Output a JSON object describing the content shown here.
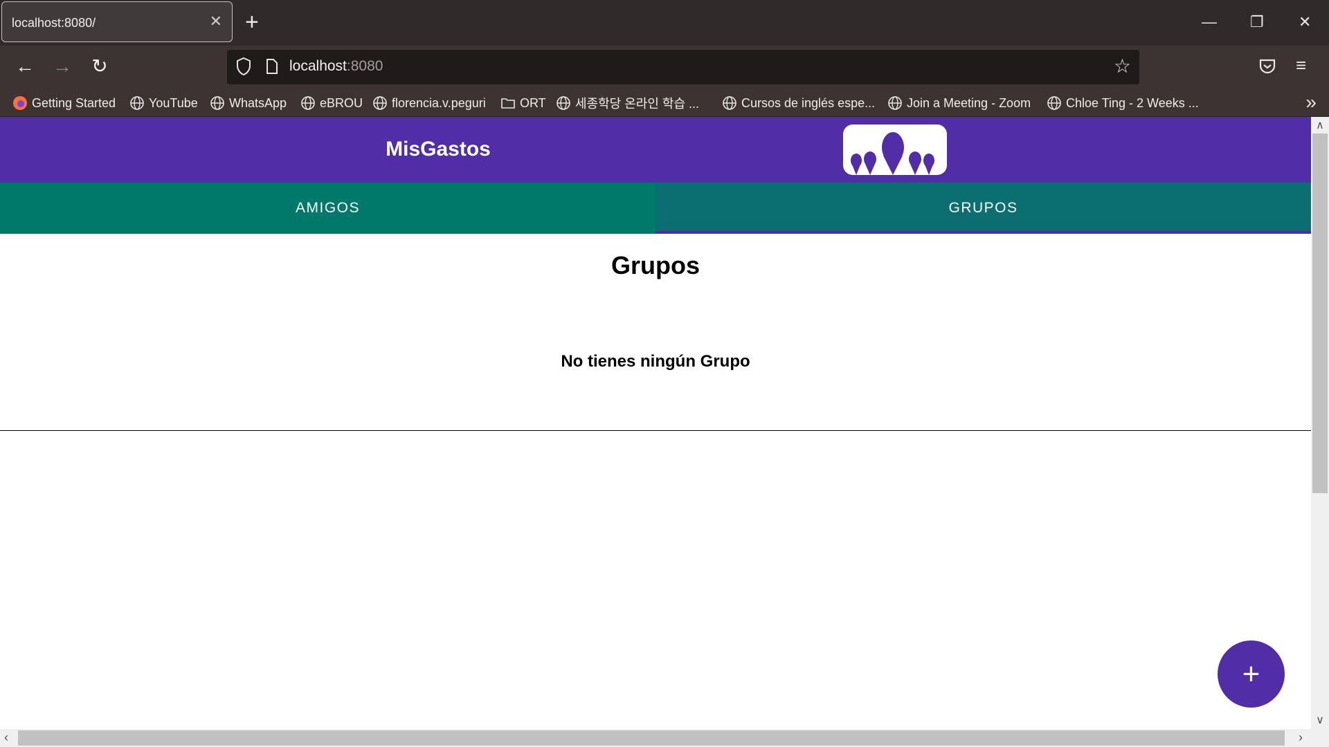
{
  "browser": {
    "tab_title": "localhost:8080/",
    "url_host": "localhost",
    "url_port": ":8080",
    "bookmarks": [
      {
        "label": "Getting Started",
        "icon": "firefox-icon"
      },
      {
        "label": "YouTube",
        "icon": "globe-icon"
      },
      {
        "label": "WhatsApp",
        "icon": "globe-icon"
      },
      {
        "label": "eBROU",
        "icon": "globe-icon"
      },
      {
        "label": "florencia.v.peguri",
        "icon": "globe-icon"
      },
      {
        "label": "ORT",
        "icon": "folder-icon"
      },
      {
        "label": "세종학당 온라인 학습 ...",
        "icon": "globe-icon"
      },
      {
        "label": "Cursos de inglés espe...",
        "icon": "globe-icon"
      },
      {
        "label": "Join a Meeting - Zoom",
        "icon": "globe-icon"
      },
      {
        "label": "Chloe Ting - 2 Weeks ...",
        "icon": "globe-icon"
      }
    ]
  },
  "app": {
    "title": "MisGastos",
    "tabs": [
      "AMIGOS",
      "GRUPOS"
    ],
    "active_tab": "GRUPOS",
    "page_title": "Grupos",
    "empty_message": "No tienes ningún Grupo",
    "fab_label": "+",
    "colors": {
      "primary": "#512da8",
      "tabs": "#00796b",
      "active_tab": "#0b6e70"
    }
  }
}
